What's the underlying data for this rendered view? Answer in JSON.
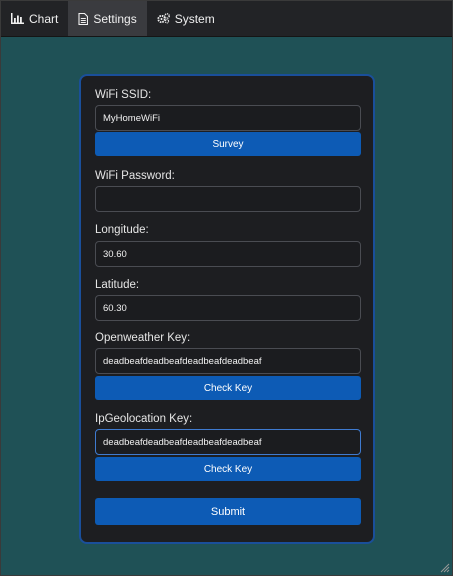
{
  "nav": {
    "tabs": [
      {
        "label": "Chart",
        "icon": "bar-chart-icon",
        "active": false
      },
      {
        "label": "Settings",
        "icon": "document-icon",
        "active": true
      },
      {
        "label": "System",
        "icon": "gears-icon",
        "active": false
      }
    ]
  },
  "form": {
    "wifi_ssid_label": "WiFi SSID:",
    "wifi_ssid_value": "MyHomeWiFi",
    "survey_button": "Survey",
    "wifi_password_label": "WiFi Password:",
    "wifi_password_value": "",
    "longitude_label": "Longitude:",
    "longitude_value": "30.60",
    "latitude_label": "Latitude:",
    "latitude_value": "60.30",
    "openweather_label": "Openweather Key:",
    "openweather_value": "deadbeafdeadbeafdeadbeafdeadbeaf",
    "openweather_check_button": "Check Key",
    "ipgeo_label": "IpGeolocation Key:",
    "ipgeo_value": "deadbeafdeadbeafdeadbeafdeadbeaf",
    "ipgeo_check_button": "Check Key",
    "submit_button": "Submit"
  },
  "colors": {
    "background": "#1f5156",
    "navbar": "#222326",
    "card": "#1d1e21",
    "card_border": "#1a4f9a",
    "button": "#0d5bb5"
  }
}
